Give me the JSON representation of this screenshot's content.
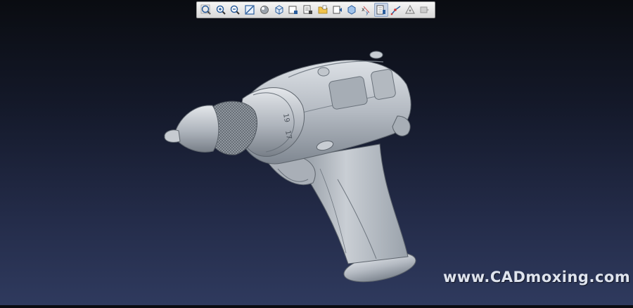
{
  "window": {
    "background_top": "#0a0c11",
    "background_bottom": "#2f3a5e"
  },
  "toolbar": {
    "buttons": [
      {
        "icon": "zoom-fit-icon",
        "active": false
      },
      {
        "icon": "zoom-in-icon",
        "active": false
      },
      {
        "icon": "zoom-out-icon",
        "active": false
      },
      {
        "icon": "zoom-area-icon",
        "active": false
      },
      {
        "icon": "shaded-sphere-icon",
        "active": false
      },
      {
        "icon": "cube-view-icon",
        "active": false
      },
      {
        "icon": "saved-view-icon",
        "active": false
      },
      {
        "icon": "layer-icon",
        "active": false
      },
      {
        "icon": "folder-icon",
        "active": false
      },
      {
        "icon": "render-icon",
        "active": false
      },
      {
        "icon": "transparency-icon",
        "active": false
      },
      {
        "icon": "annotation-icon",
        "active": false
      },
      {
        "icon": "section-icon",
        "active": true
      },
      {
        "icon": "measure-icon",
        "active": false
      },
      {
        "icon": "datum-icon",
        "active": false
      },
      {
        "icon": "spin-icon",
        "active": false
      }
    ]
  },
  "model": {
    "part_label": "drill-model",
    "surface_color": "#b9bfc6",
    "dial_numbers": [
      "19",
      "17"
    ]
  },
  "watermark": {
    "text": "www.CADmoxing.com"
  }
}
